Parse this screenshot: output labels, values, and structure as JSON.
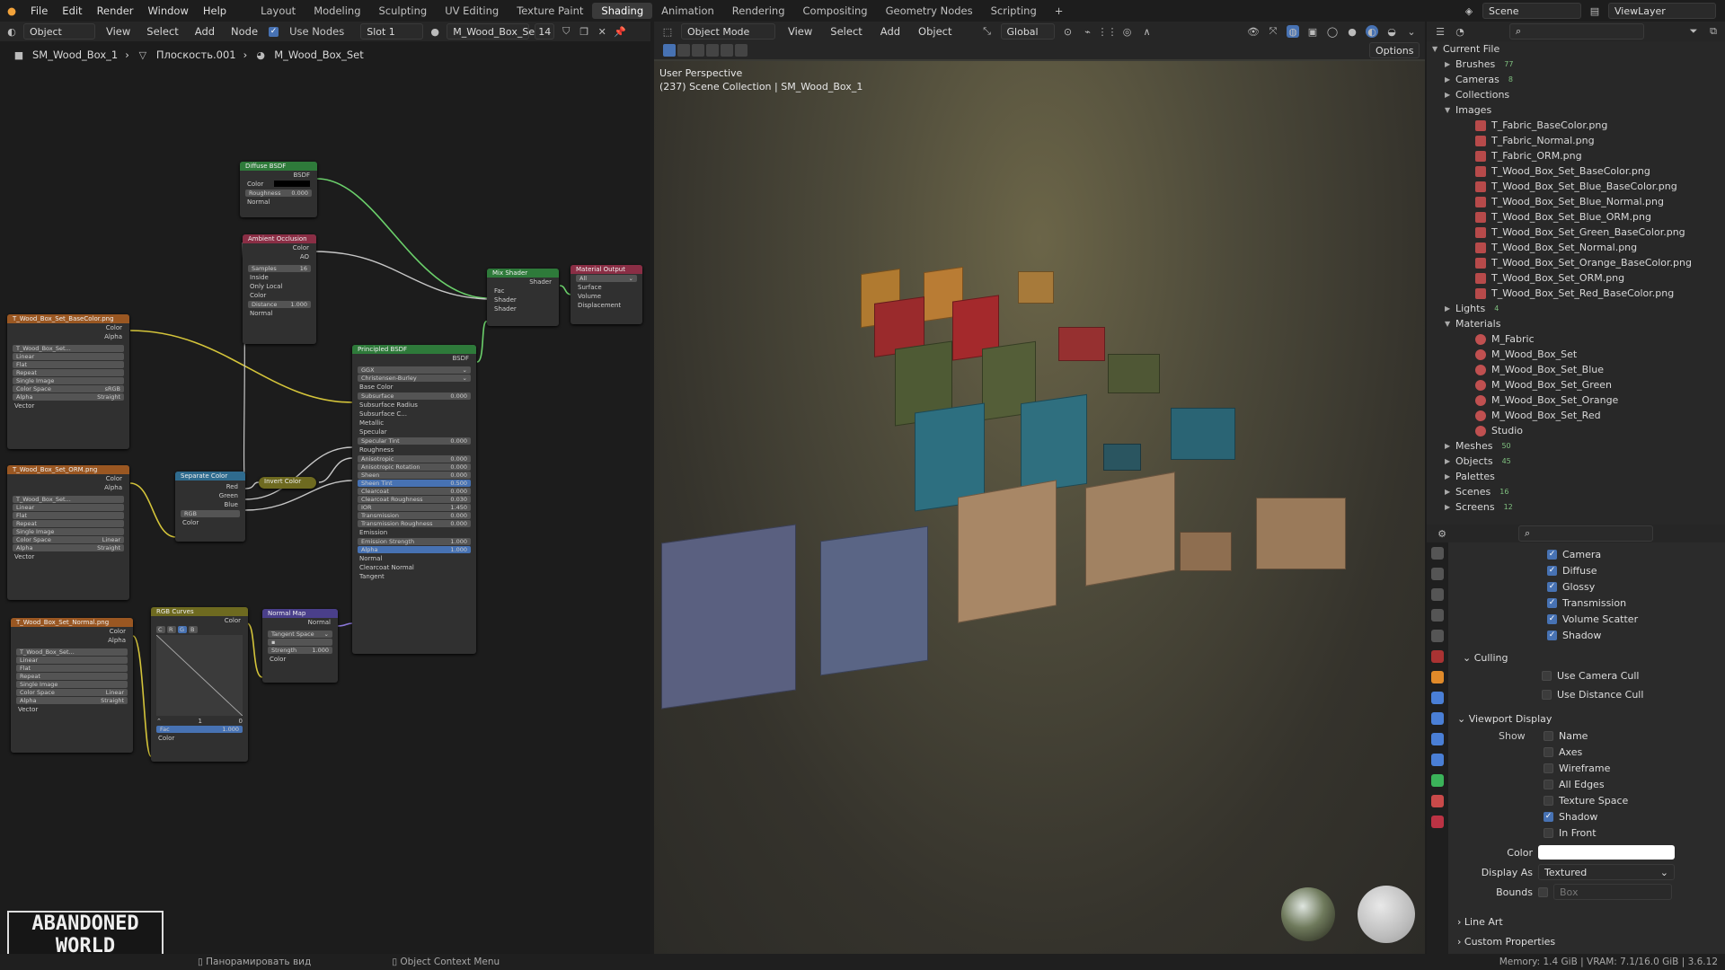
{
  "topbar": {
    "menus": [
      "File",
      "Edit",
      "Render",
      "Window",
      "Help"
    ],
    "workspaces": [
      "Layout",
      "Modeling",
      "Sculpting",
      "UV Editing",
      "Texture Paint",
      "Shading",
      "Animation",
      "Rendering",
      "Compositing",
      "Geometry Nodes",
      "Scripting"
    ],
    "active_workspace": "Shading",
    "scene": "Scene",
    "view_layer": "ViewLayer"
  },
  "node_editor": {
    "mode": "Object",
    "menus": [
      "View",
      "Select",
      "Add",
      "Node"
    ],
    "use_nodes": "Use Nodes",
    "slot": "Slot 1",
    "material": "M_Wood_Box_Set",
    "users": "14",
    "breadcrumb": [
      "SM_Wood_Box_1",
      "Плоскость.001",
      "M_Wood_Box_Set"
    ],
    "nodes": {
      "diffuse": {
        "title": "Diffuse BSDF",
        "out": "BSDF",
        "color": "Color",
        "roughness": "Roughness",
        "roughness_val": "0.000",
        "normal": "Normal"
      },
      "ao": {
        "title": "Ambient Occlusion",
        "color": "Color",
        "ao": "AO",
        "samples": "Samples",
        "samples_val": "16",
        "inside": "Inside",
        "only_local": "Only Local",
        "color_in": "Color",
        "distance": "Distance",
        "distance_val": "1.000",
        "normal": "Normal"
      },
      "mix": {
        "title": "Mix Shader",
        "out": "Shader",
        "fac": "Fac",
        "s1": "Shader",
        "s2": "Shader"
      },
      "output": {
        "title": "Material Output",
        "target": "All",
        "surface": "Surface",
        "volume": "Volume",
        "displacement": "Displacement"
      },
      "tex_base": {
        "title": "T_Wood_Box_Set_BaseColor.png",
        "color": "Color",
        "alpha": "Alpha",
        "img": "T_Wood_Box_Set...",
        "interp": "Linear",
        "proj": "Flat",
        "ext": "Repeat",
        "src": "Single Image",
        "cs_label": "Color Space",
        "cs": "sRGB",
        "alpha_label": "Alpha",
        "alpha_mode": "Straight",
        "vector": "Vector"
      },
      "tex_orm": {
        "title": "T_Wood_Box_Set_ORM.png",
        "color": "Color",
        "alpha": "Alpha",
        "img": "T_Wood_Box_Set...",
        "interp": "Linear",
        "proj": "Flat",
        "ext": "Repeat",
        "src": "Single Image",
        "cs_label": "Color Space",
        "cs": "Linear",
        "alpha_label": "Alpha",
        "alpha_mode": "Straight",
        "vector": "Vector"
      },
      "tex_normal": {
        "title": "T_Wood_Box_Set_Normal.png",
        "color": "Color",
        "alpha": "Alpha",
        "img": "T_Wood_Box_Set...",
        "interp": "Linear",
        "proj": "Flat",
        "ext": "Repeat",
        "src": "Single Image",
        "cs_label": "Color Space",
        "cs": "Linear",
        "alpha_label": "Alpha",
        "alpha_mode": "Straight",
        "vector": "Vector"
      },
      "separate": {
        "title": "Separate Color",
        "red": "Red",
        "green": "Green",
        "blue": "Blue",
        "mode": "RGB",
        "color": "Color"
      },
      "invert": {
        "title": "Invert Color"
      },
      "curves": {
        "title": "RGB Curves",
        "color": "Color",
        "channels": [
          "C",
          "R",
          "G",
          "B"
        ],
        "v1": "1",
        "v2": "0",
        "fac": "Fac",
        "fac_val": "1.000",
        "color_in": "Color"
      },
      "normal_map": {
        "title": "Normal Map",
        "normal": "Normal",
        "space": "Tangent Space",
        "strength": "Strength",
        "strength_val": "1.000",
        "color": "Color"
      },
      "principled": {
        "title": "Principled BSDF",
        "out": "BSDF",
        "dist": "GGX",
        "sss": "Christensen-Burley",
        "rows": [
          {
            "label": "Base Color",
            "val": ""
          },
          {
            "label": "Subsurface",
            "val": "0.000"
          },
          {
            "label": "Subsurface Radius",
            "val": ""
          },
          {
            "label": "Subsurface C...",
            "val": ""
          },
          {
            "label": "Metallic",
            "val": ""
          },
          {
            "label": "Specular",
            "val": ""
          },
          {
            "label": "Specular Tint",
            "val": "0.000"
          },
          {
            "label": "Roughness",
            "val": ""
          },
          {
            "label": "Anisotropic",
            "val": "0.000"
          },
          {
            "label": "Anisotropic Rotation",
            "val": "0.000"
          },
          {
            "label": "Sheen",
            "val": "0.000"
          },
          {
            "label": "Sheen Tint",
            "val": "0.500"
          },
          {
            "label": "Clearcoat",
            "val": "0.000"
          },
          {
            "label": "Clearcoat Roughness",
            "val": "0.030"
          },
          {
            "label": "IOR",
            "val": "1.450"
          },
          {
            "label": "Transmission",
            "val": "0.000"
          },
          {
            "label": "Transmission Roughness",
            "val": "0.000"
          },
          {
            "label": "Emission",
            "val": ""
          },
          {
            "label": "Emission Strength",
            "val": "1.000"
          },
          {
            "label": "Alpha",
            "val": "1.000"
          },
          {
            "label": "Normal",
            "val": ""
          },
          {
            "label": "Clearcoat Normal",
            "val": ""
          },
          {
            "label": "Tangent",
            "val": ""
          }
        ]
      }
    }
  },
  "viewport": {
    "mode": "Object Mode",
    "menus": [
      "View",
      "Select",
      "Add",
      "Object"
    ],
    "orientation": "Global",
    "options": "Options",
    "perspective": "User Perspective",
    "collection": "(237) Scene Collection | SM_Wood_Box_1"
  },
  "outliner": {
    "root": "Current File",
    "items": [
      {
        "label": "Brushes",
        "expanded": false,
        "count": "77"
      },
      {
        "label": "Cameras",
        "expanded": false,
        "count": "8"
      },
      {
        "label": "Collections",
        "expanded": false,
        "count": ""
      },
      {
        "label": "Images",
        "expanded": true,
        "count": "",
        "children": [
          "T_Fabric_BaseColor.png",
          "T_Fabric_Normal.png",
          "T_Fabric_ORM.png",
          "T_Wood_Box_Set_BaseColor.png",
          "T_Wood_Box_Set_Blue_BaseColor.png",
          "T_Wood_Box_Set_Blue_Normal.png",
          "T_Wood_Box_Set_Blue_ORM.png",
          "T_Wood_Box_Set_Green_BaseColor.png",
          "T_Wood_Box_Set_Normal.png",
          "T_Wood_Box_Set_Orange_BaseColor.png",
          "T_Wood_Box_Set_ORM.png",
          "T_Wood_Box_Set_Red_BaseColor.png"
        ]
      },
      {
        "label": "Lights",
        "expanded": false,
        "count": "4"
      },
      {
        "label": "Materials",
        "expanded": true,
        "count": "",
        "children": [
          "M_Fabric",
          "M_Wood_Box_Set",
          "M_Wood_Box_Set_Blue",
          "M_Wood_Box_Set_Green",
          "M_Wood_Box_Set_Orange",
          "M_Wood_Box_Set_Red",
          "Studio"
        ]
      },
      {
        "label": "Meshes",
        "expanded": false,
        "count": "50"
      },
      {
        "label": "Objects",
        "expanded": false,
        "count": "45"
      },
      {
        "label": "Palettes",
        "expanded": false,
        "count": ""
      },
      {
        "label": "Scenes",
        "expanded": false,
        "count": "16"
      },
      {
        "label": "Screens",
        "expanded": false,
        "count": "12"
      }
    ]
  },
  "properties": {
    "visibility": [
      "Camera",
      "Diffuse",
      "Glossy",
      "Transmission",
      "Volume Scatter",
      "Shadow"
    ],
    "culling": {
      "title": "Culling",
      "items": [
        "Use Camera Cull",
        "Use Distance Cull"
      ]
    },
    "viewport_display": {
      "title": "Viewport Display",
      "show_label": "Show",
      "items": [
        {
          "label": "Name",
          "on": false
        },
        {
          "label": "Axes",
          "on": false
        },
        {
          "label": "Wireframe",
          "on": false
        },
        {
          "label": "All Edges",
          "on": false
        },
        {
          "label": "Texture Space",
          "on": false
        },
        {
          "label": "Shadow",
          "on": true
        },
        {
          "label": "In Front",
          "on": false
        }
      ],
      "color_label": "Color",
      "display_as_label": "Display As",
      "display_as": "Textured",
      "bounds_label": "Bounds",
      "bounds": "Box"
    },
    "line_art": "Line Art",
    "custom_properties": "Custom Properties"
  },
  "statusbar": {
    "pan": "Панорамировать вид",
    "context": "Object Context Menu",
    "memory": "Memory: 1.4 GiB | VRAM: 7.1/16.0 GiB | 3.6.12"
  },
  "logo": {
    "line1": "ABANDONED",
    "line2": "WORLD"
  }
}
